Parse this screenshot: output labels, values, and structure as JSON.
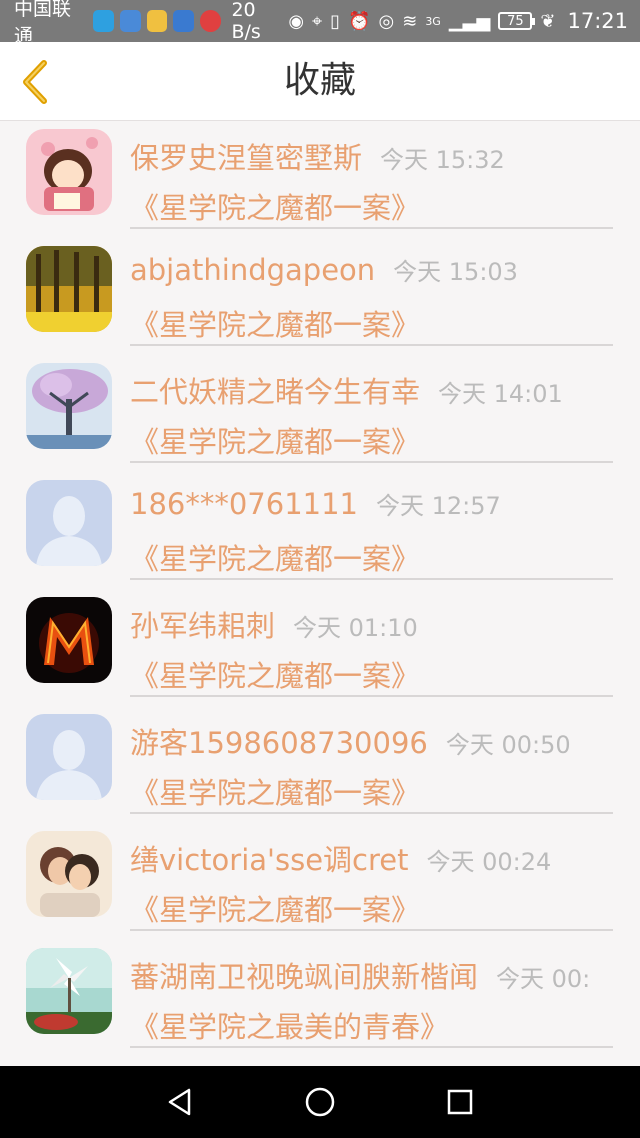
{
  "status_bar": {
    "carrier": "中国联通",
    "speed": "20 B/s",
    "battery": "75",
    "time": "17:21",
    "network": "3G"
  },
  "header": {
    "title": "收藏",
    "back_icon": "chevron-left-icon"
  },
  "favorites": [
    {
      "name": "保罗史涅篁密墅斯",
      "time": "今天 15:32",
      "work": "《星学院之魔都一案》",
      "avatar": "anime-girl"
    },
    {
      "name": "abjathindgapeon",
      "time": "今天 15:03",
      "work": "《星学院之魔都一案》",
      "avatar": "autumn-trees"
    },
    {
      "name": "二代妖精之睹今生有幸",
      "time": "今天 14:01",
      "work": "《星学院之魔都一案》",
      "avatar": "blossom-tree"
    },
    {
      "name": "186***0761111",
      "time": "今天 12:57",
      "work": "《星学院之魔都一案》",
      "avatar": "default-user"
    },
    {
      "name": "孙军纬耜刺",
      "time": "今天 01:10",
      "work": "《星学院之魔都一案》",
      "avatar": "fire-letter-m"
    },
    {
      "name": "游客1598608730096",
      "time": "今天 00:50",
      "work": "《星学院之魔都一案》",
      "avatar": "default-user"
    },
    {
      "name": "缮victoria'sse调cret",
      "time": "今天 00:24",
      "work": "《星学院之魔都一案》",
      "avatar": "couple"
    },
    {
      "name": "蕃湖南卫视晚飒间腴新楷闻",
      "time": "今天 00:",
      "work": "《星学院之最美的青春》",
      "avatar": "pinwheel"
    }
  ],
  "nav_bar": {
    "back": "triangle-back-icon",
    "home": "circle-home-icon",
    "recents": "square-recents-icon"
  },
  "colors": {
    "accent": "#e8a070",
    "time_gray": "#bbbbbb",
    "back_arrow": "#e0a000",
    "background": "#f7f5f5"
  }
}
